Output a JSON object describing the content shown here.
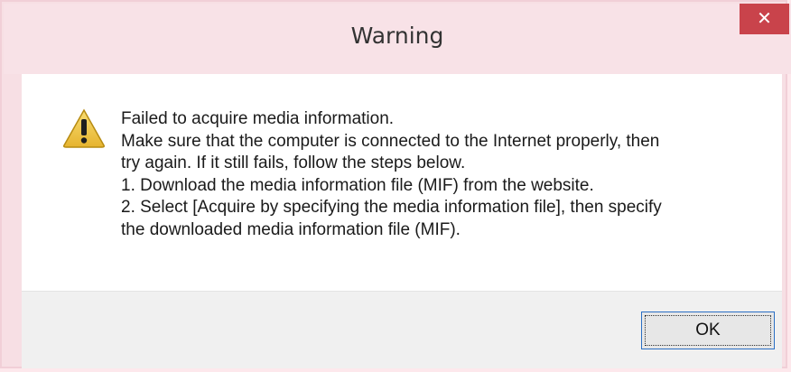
{
  "dialog": {
    "title": "Warning",
    "close_icon": "close-icon",
    "close_glyph": "✕",
    "warning_icon": "warning-triangle-icon",
    "message_lines": [
      "Failed to acquire media information.",
      "Make sure that the computer is connected to the Internet properly, then",
      "try again. If it still fails, follow the steps below.",
      "1. Download the media information file (MIF) from the website.",
      "2. Select [Acquire by specifying the media information file], then specify",
      "the downloaded media information file (MIF)."
    ],
    "ok_label": "OK"
  },
  "colors": {
    "title_bar": "#f8e2e7",
    "close_button": "#c9434b",
    "content_bg": "#ffffff",
    "footer_bg": "#f0f0f0",
    "ok_border": "#2b6fc4",
    "warning_fill": "#f2c94c"
  }
}
